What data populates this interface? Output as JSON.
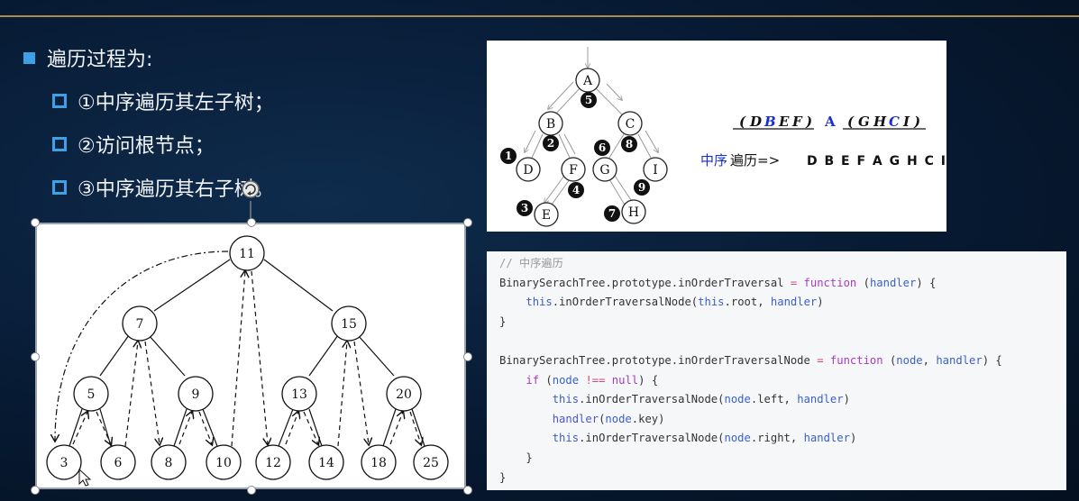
{
  "bullets": {
    "main": "遍历过程为:",
    "items": [
      "①中序遍历其左子树；",
      "②访问根节点；",
      "③中序遍历其右子树。"
    ]
  },
  "small_tree": {
    "nodes": [
      "A",
      "B",
      "C",
      "D",
      "F",
      "G",
      "I",
      "E",
      "H"
    ],
    "step_numbers": [
      "1",
      "2",
      "3",
      "4",
      "5",
      "6",
      "7",
      "8",
      "9"
    ],
    "grouping": {
      "open1": "(",
      "d": "D",
      "b": "B",
      "e": "E",
      "f": "F",
      "close1": ")",
      "a": "A",
      "open2": "(",
      "g": "G",
      "h": "H",
      "c": "C",
      "i": "I",
      "close2": ")"
    },
    "result_label_blue": "中序",
    "result_label_rest": "遍历=>",
    "result_sequence": "D B E F A G H C I"
  },
  "code": {
    "comment": "// 中序遍历",
    "l1a": "BinarySerachTree.prototype.inOrderTraversal",
    "l1b": "function",
    "l1c": "handler",
    "l2a": "this",
    "l2b": ".inOrderTraversalNode(",
    "l2c": "this",
    "l2d": ".root, ",
    "l2e": "handler",
    "l3": "}",
    "l4a": "BinarySerachTree.prototype.inOrderTraversalNode",
    "l4b": "function",
    "l4c": "node",
    "l4d": "handler",
    "l5a": "if",
    "l5b": "node",
    "l5c": "!==",
    "l5d": "null",
    "l6a": "this",
    "l6b": ".inOrderTraversalNode(",
    "l6c": "node",
    "l6d": ".left, ",
    "l6e": "handler",
    "l7a": "handler",
    "l7b": "node",
    "l7c": ".key)",
    "l8a": "this",
    "l8b": ".inOrderTraversalNode(",
    "l8c": "node",
    "l8d": ".right, ",
    "l8e": "handler",
    "l9": "}",
    "l10": "}"
  },
  "big_tree": {
    "root": "11",
    "level2": [
      "7",
      "15"
    ],
    "level3": [
      "5",
      "9",
      "13",
      "20"
    ],
    "leaves": [
      "3",
      "6",
      "8",
      "10",
      "12",
      "14",
      "18",
      "25"
    ]
  }
}
